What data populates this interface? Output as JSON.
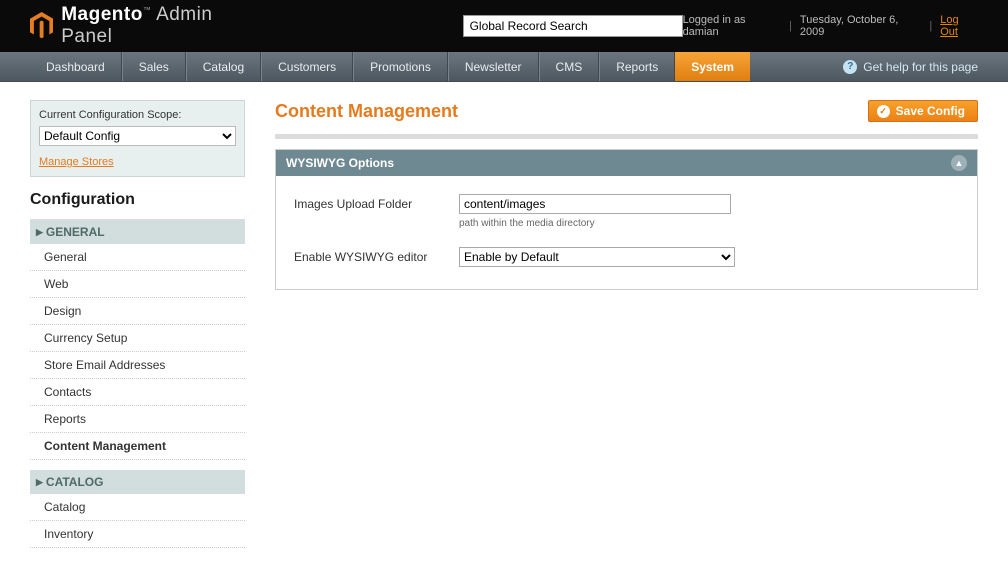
{
  "header": {
    "brand": "Magento",
    "panel": "Admin Panel",
    "search_placeholder": "Global Record Search",
    "logged_in": "Logged in as damian",
    "date": "Tuesday, October 6, 2009",
    "logout": "Log Out"
  },
  "nav": {
    "items": [
      "Dashboard",
      "Sales",
      "Catalog",
      "Customers",
      "Promotions",
      "Newsletter",
      "CMS",
      "Reports",
      "System"
    ],
    "active": "System",
    "help": "Get help for this page"
  },
  "scope": {
    "label": "Current Configuration Scope:",
    "value": "Default Config",
    "manage": "Manage Stores"
  },
  "sidebar": {
    "title": "Configuration",
    "groups": [
      {
        "name": "GENERAL",
        "items": [
          "General",
          "Web",
          "Design",
          "Currency Setup",
          "Store Email Addresses",
          "Contacts",
          "Reports",
          "Content Management"
        ],
        "active": "Content Management"
      },
      {
        "name": "CATALOG",
        "items": [
          "Catalog",
          "Inventory"
        ],
        "active": ""
      }
    ]
  },
  "page": {
    "title": "Content Management",
    "save": "Save Config"
  },
  "fieldset": {
    "title": "WYSIWYG Options",
    "rows": [
      {
        "label": "Images Upload Folder",
        "value": "content/images",
        "hint": "path within the media directory",
        "type": "text"
      },
      {
        "label": "Enable WYSIWYG editor",
        "value": "Enable by Default",
        "hint": "",
        "type": "select"
      }
    ]
  }
}
